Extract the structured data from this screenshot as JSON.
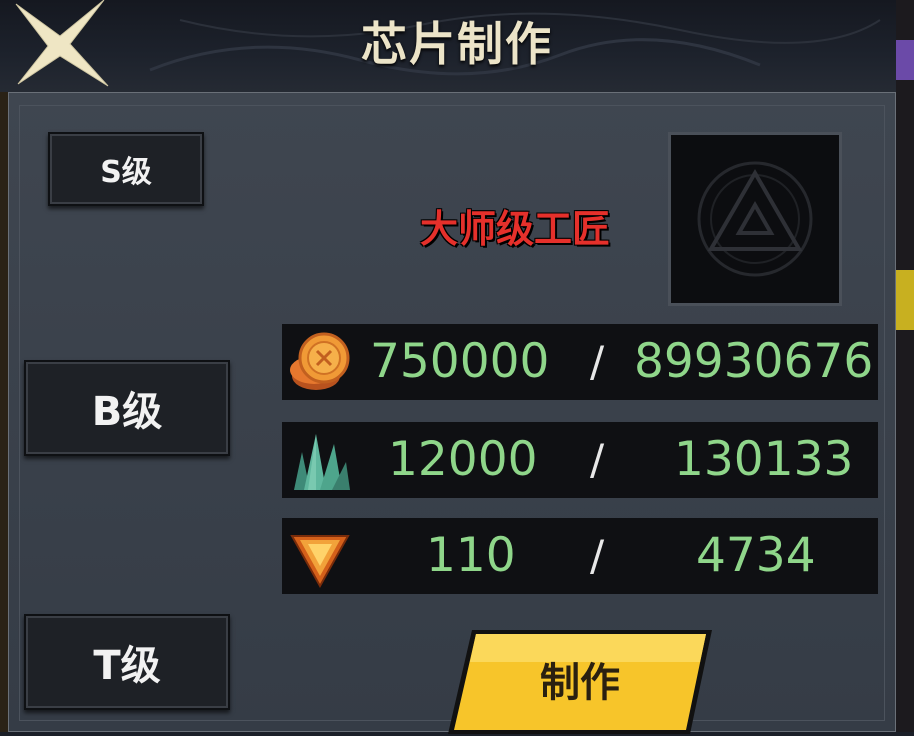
{
  "window": {
    "title": "芯片制作"
  },
  "tiers": [
    {
      "label": "S级"
    },
    {
      "label": "B级"
    },
    {
      "label": "T级"
    }
  ],
  "rank_label": "大师级工匠",
  "resources": [
    {
      "icon": "gold-coin-icon",
      "required": "750000",
      "separator": "/",
      "owned": "89930676"
    },
    {
      "icon": "green-crystal-icon",
      "required": "12000",
      "separator": "/",
      "owned": "130133"
    },
    {
      "icon": "orange-gem-icon",
      "required": "110",
      "separator": "/",
      "owned": "4734"
    }
  ],
  "craft_button": {
    "label": "制作"
  },
  "colors": {
    "value_green": "#8fd68a",
    "rank_red": "#e5302b",
    "button_yellow": "#f7c52a",
    "title_cream": "#ece4c8"
  }
}
